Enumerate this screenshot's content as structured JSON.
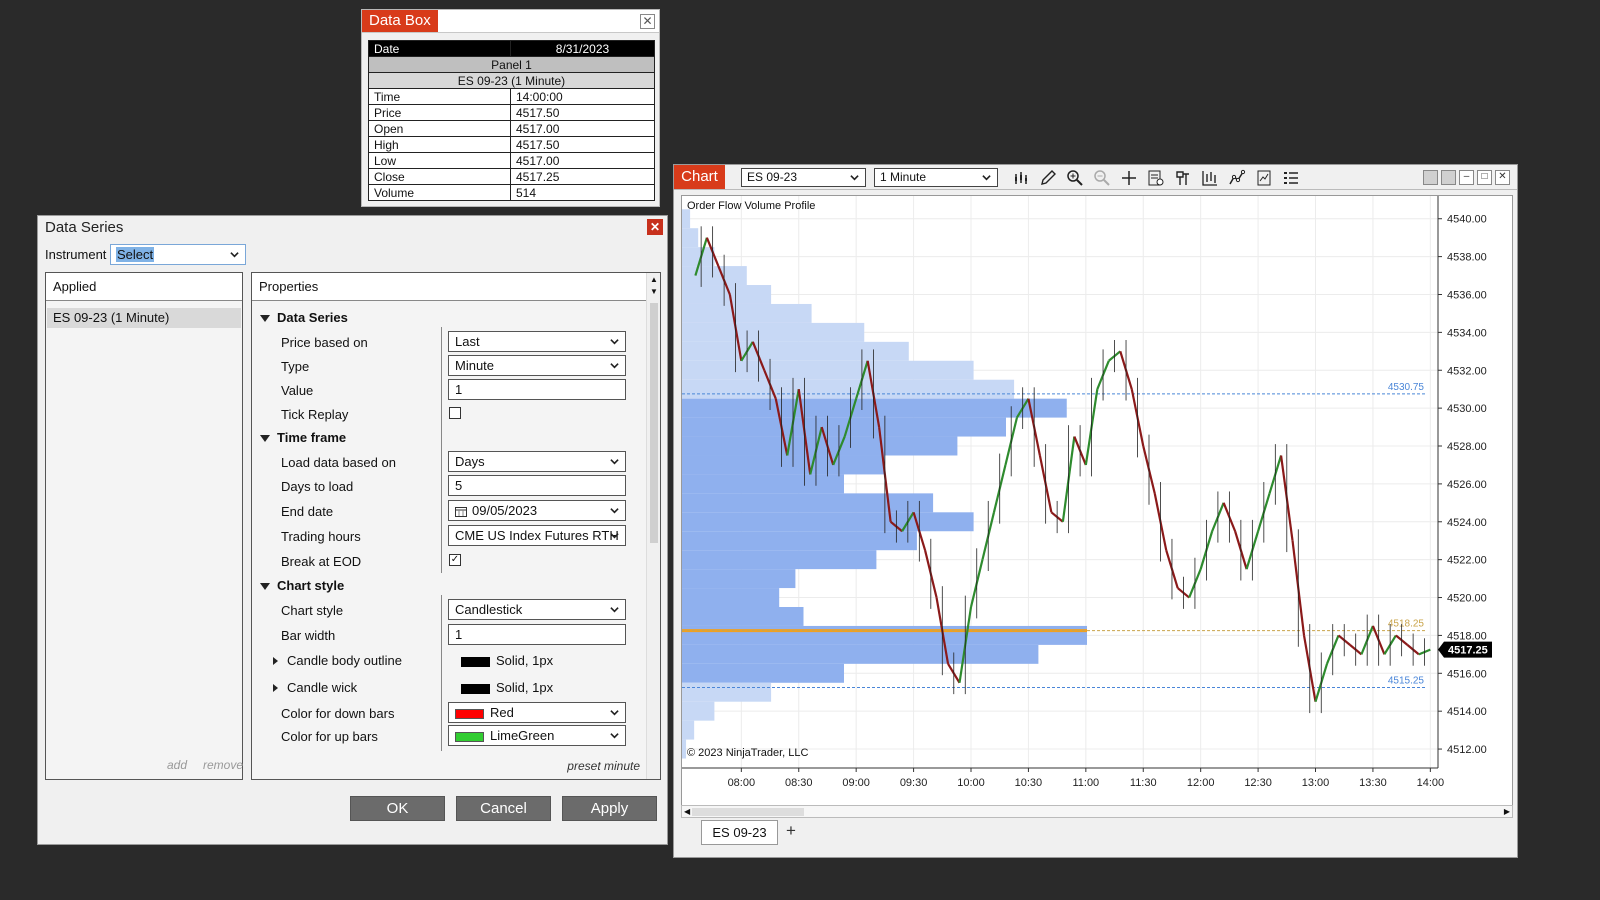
{
  "databox": {
    "title": "Data Box",
    "date_label": "Date",
    "date_value": "8/31/2023",
    "panel": "Panel 1",
    "instrument": "ES 09-23 (1 Minute)",
    "rows": [
      {
        "label": "Time",
        "value": "14:00:00"
      },
      {
        "label": "Price",
        "value": "4517.50"
      },
      {
        "label": "Open",
        "value": "4517.00"
      },
      {
        "label": "High",
        "value": "4517.50"
      },
      {
        "label": "Low",
        "value": "4517.00"
      },
      {
        "label": "Close",
        "value": "4517.25"
      },
      {
        "label": "Volume",
        "value": "514"
      }
    ]
  },
  "dataseries": {
    "title": "Data Series",
    "close_icon": "close-icon",
    "instrument_label": "Instrument",
    "instrument_value": "Select",
    "applied_header": "Applied",
    "applied_item": "ES 09-23 (1 Minute)",
    "add_label": "add",
    "remove_label": "remove",
    "properties_header": "Properties",
    "sections": {
      "data_series": "Data Series",
      "time_frame": "Time frame",
      "chart_style": "Chart style"
    },
    "props": {
      "price_based_on": {
        "label": "Price based on",
        "value": "Last"
      },
      "type": {
        "label": "Type",
        "value": "Minute"
      },
      "value": {
        "label": "Value",
        "value": "1"
      },
      "tick_replay": {
        "label": "Tick Replay",
        "checked": false
      },
      "load_based_on": {
        "label": "Load data based on",
        "value": "Days"
      },
      "days_to_load": {
        "label": "Days to load",
        "value": "5"
      },
      "end_date": {
        "label": "End date",
        "value": "09/05/2023"
      },
      "trading_hours": {
        "label": "Trading hours",
        "value": "CME US Index Futures RTH"
      },
      "break_at_eod": {
        "label": "Break at EOD",
        "checked": true
      },
      "chart_style": {
        "label": "Chart style",
        "value": "Candlestick"
      },
      "bar_width": {
        "label": "Bar width",
        "value": "1"
      },
      "body_outline": {
        "label": "Candle body outline",
        "value": "Solid, 1px",
        "color": "#000000"
      },
      "candle_wick": {
        "label": "Candle wick",
        "value": "Solid, 1px",
        "color": "#000000"
      },
      "down_color": {
        "label": "Color for down bars",
        "value": "Red",
        "color": "#ff0000"
      },
      "up_color": {
        "label": "Color for up bars",
        "value": "LimeGreen",
        "color": "#32cd32"
      }
    },
    "preset": "preset minute",
    "buttons": {
      "ok": "OK",
      "cancel": "Cancel",
      "apply": "Apply"
    }
  },
  "chart": {
    "window_title": "Chart",
    "instrument_select": "ES 09-23",
    "interval_select": "1 Minute",
    "indicator_label": "Order Flow Volume Profile",
    "copyright": "© 2023 NinjaTrader, LLC",
    "tab_label": "ES 09-23",
    "add_tab": "+",
    "colors": {
      "up": "#2e8b2e",
      "down": "#8b1a1a",
      "profile_light": "#c7d8f5",
      "profile_value_area": "#8fb0ee",
      "poc": "#f0a020",
      "level_line": "#4a86d8"
    },
    "toolbar_icons": [
      "bars-type-icon",
      "draw-pencil-icon",
      "zoom-in-icon",
      "zoom-out-icon",
      "crosshair-icon",
      "data-box-icon",
      "properties-icon",
      "chart-trader-icon",
      "indicators-icon",
      "strategies-icon",
      "templates-icon"
    ]
  },
  "chart_data": {
    "type": "line",
    "title": "",
    "xlabel": "",
    "ylabel": "",
    "x_ticks": [
      "08:00",
      "08:30",
      "09:00",
      "09:30",
      "10:00",
      "10:30",
      "11:00",
      "11:30",
      "12:00",
      "12:30",
      "13:00",
      "13:30",
      "14:00"
    ],
    "y_ticks": [
      "4540.00",
      "4538.00",
      "4536.00",
      "4534.00",
      "4532.00",
      "4530.00",
      "4528.00",
      "4526.00",
      "4524.00",
      "4522.00",
      "4520.00",
      "4518.00",
      "4516.00",
      "4514.00",
      "4512.00"
    ],
    "ylim": [
      4511,
      4541.2
    ],
    "series": [
      {
        "x": [
          "07:36",
          "07:42",
          "07:48",
          "07:54",
          "08:00",
          "08:06",
          "08:12",
          "08:18",
          "08:24",
          "08:30",
          "08:36",
          "08:42",
          "08:48",
          "08:54",
          "09:00",
          "09:06",
          "09:12",
          "09:18",
          "09:24",
          "09:30",
          "09:36",
          "09:42",
          "09:48",
          "09:54",
          "10:00",
          "10:06",
          "10:12",
          "10:18",
          "10:24",
          "10:30",
          "10:36",
          "10:42",
          "10:48",
          "10:54",
          "11:00",
          "11:06",
          "11:12",
          "11:18",
          "11:24",
          "11:30",
          "11:36",
          "11:42",
          "11:48",
          "11:54",
          "12:00",
          "12:06",
          "12:12",
          "12:18",
          "12:24",
          "12:30",
          "12:36",
          "12:42",
          "12:48",
          "12:54",
          "13:00",
          "13:06",
          "13:12",
          "13:18",
          "13:24",
          "13:30",
          "13:36",
          "13:42",
          "13:48",
          "13:54",
          "14:00"
        ],
        "values": [
          4537.0,
          4539.0,
          4537.5,
          4536.0,
          4532.5,
          4533.5,
          4532.0,
          4530.5,
          4527.5,
          4531.0,
          4526.5,
          4529.0,
          4527.0,
          4528.5,
          4530.5,
          4532.5,
          4529.0,
          4524.0,
          4523.5,
          4524.5,
          4522.5,
          4520.0,
          4516.5,
          4515.5,
          4519.5,
          4522.0,
          4524.5,
          4527.0,
          4529.5,
          4530.5,
          4527.5,
          4524.5,
          4524.0,
          4528.5,
          4527.0,
          4531.0,
          4532.5,
          4533.0,
          4531.0,
          4528.0,
          4525.5,
          4522.5,
          4520.5,
          4520.0,
          4521.5,
          4523.5,
          4525.0,
          4523.5,
          4521.5,
          4523.5,
          4525.5,
          4527.5,
          4523.0,
          4518.0,
          4514.5,
          4516.5,
          4518.0,
          4517.5,
          4517.0,
          4518.5,
          4517.0,
          4518.0,
          4517.5,
          4517.0,
          4517.25
        ]
      }
    ],
    "price_levels": [
      {
        "label": "4530.75",
        "value": 4530.75
      },
      {
        "label": "4518.25",
        "value": 4518.25
      },
      {
        "label": "4515.25",
        "value": 4515.25
      }
    ],
    "last_price": {
      "label": "4517.25",
      "value": 4517.25
    },
    "volume_profile": {
      "note_fraction_of_max": true,
      "levels": [
        4540,
        4539,
        4538,
        4537,
        4536,
        4535,
        4534,
        4533,
        4532,
        4531,
        4530,
        4529,
        4528,
        4527,
        4526,
        4525,
        4524,
        4523,
        4522,
        4521,
        4520,
        4519,
        4518,
        4517,
        4516,
        4515,
        4514,
        4513,
        4512
      ],
      "fractions": [
        0.02,
        0.04,
        0.08,
        0.16,
        0.22,
        0.32,
        0.45,
        0.56,
        0.72,
        0.82,
        0.95,
        0.8,
        0.68,
        0.5,
        0.4,
        0.62,
        0.72,
        0.58,
        0.48,
        0.28,
        0.24,
        0.3,
        1.0,
        0.88,
        0.4,
        0.22,
        0.08,
        0.03,
        0.01
      ]
    }
  }
}
